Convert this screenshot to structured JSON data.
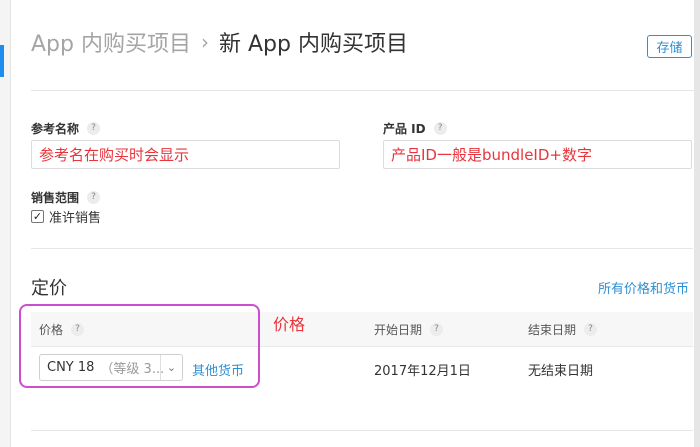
{
  "header": {
    "breadcrumb_parent": "App 内购买项目",
    "separator": "›",
    "breadcrumb_current": "新 App 内购买项目",
    "save_label": "存储"
  },
  "form": {
    "ref_name": {
      "label": "参考名称",
      "help": "?",
      "value": "参考名在购买时会显示"
    },
    "product_id": {
      "label": "产品 ID",
      "help": "?",
      "value": "产品ID一般是bundleID+数字"
    },
    "sales_scope": {
      "label": "销售范围",
      "help": "?",
      "checkbox_label": "准许销售",
      "checked": true
    }
  },
  "pricing": {
    "title": "定价",
    "all_prices_link": "所有价格和货币",
    "columns": {
      "price": "价格",
      "start_date": "开始日期",
      "end_date": "结束日期",
      "help": "?"
    },
    "row": {
      "price_select_value": "CNY 18",
      "price_select_hint": "（等级 3...",
      "other_currency_link": "其他货币",
      "start_date": "2017年12月1日",
      "end_date": "无结束日期"
    }
  },
  "annotation": {
    "label": "价格",
    "color": "#cc4fd0",
    "text_color": "#e8343c"
  },
  "colors": {
    "accent": "#2d8fd5",
    "hint_text": "#e8343c"
  }
}
